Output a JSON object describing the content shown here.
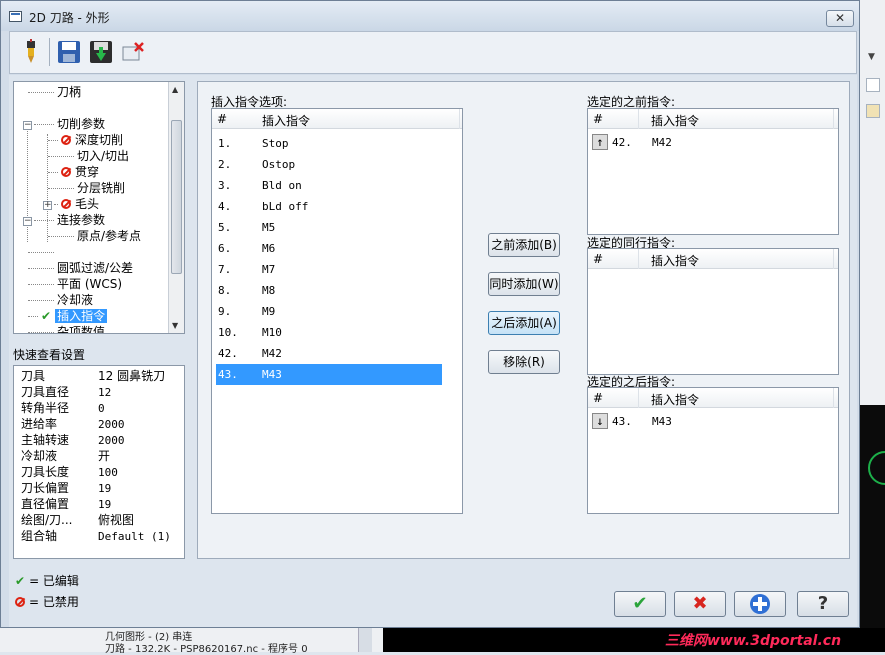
{
  "window": {
    "title": "2D 刀路 - 外形",
    "close": "✕"
  },
  "toolbar": {
    "icons": [
      "tool-icon",
      "save-icon",
      "save-green-icon",
      "delete-icon"
    ]
  },
  "tree": {
    "items": [
      {
        "label": "刀柄",
        "state": "none"
      },
      {
        "label": "切削参数",
        "state": "none"
      },
      {
        "label": "深度切削",
        "state": "disabled"
      },
      {
        "label": "切入/切出",
        "state": "none"
      },
      {
        "label": "贯穿",
        "state": "disabled"
      },
      {
        "label": "分层铣削",
        "state": "none"
      },
      {
        "label": "毛头",
        "state": "disabled"
      },
      {
        "label": "连接参数",
        "state": "none"
      },
      {
        "label": "原点/参考点",
        "state": "none"
      },
      {
        "label": "",
        "state": "none"
      },
      {
        "label": "圆弧过滤/公差",
        "state": "none"
      },
      {
        "label": "平面 (WCS)",
        "state": "none"
      },
      {
        "label": "冷却液",
        "state": "none"
      },
      {
        "label": "插入指令",
        "state": "edited"
      },
      {
        "label": "杂项数值",
        "state": "none"
      }
    ]
  },
  "quick_view": {
    "title": "快速查看设置",
    "rows": [
      {
        "k": "刀具",
        "v": "12 圆鼻铣刀"
      },
      {
        "k": "刀具直径",
        "v": "12"
      },
      {
        "k": "转角半径",
        "v": "0"
      },
      {
        "k": "进给率",
        "v": "2000"
      },
      {
        "k": "主轴转速",
        "v": "2000"
      },
      {
        "k": "冷却液",
        "v": "开"
      },
      {
        "k": "刀具长度",
        "v": "100"
      },
      {
        "k": "刀长偏置",
        "v": "19"
      },
      {
        "k": "直径偏置",
        "v": "19"
      },
      {
        "k": "绘图/刀...",
        "v": "俯视图"
      },
      {
        "k": "组合轴",
        "v": "Default (1)"
      }
    ]
  },
  "legend": {
    "edited": "= 已编辑",
    "disabled": "= 已禁用"
  },
  "options": {
    "label": "插入指令选项:",
    "col_num": "#",
    "col_cmd": "插入指令",
    "items": [
      {
        "n": "1.",
        "t": "Stop"
      },
      {
        "n": "2.",
        "t": "Ostop"
      },
      {
        "n": "3.",
        "t": "Bld on"
      },
      {
        "n": "4.",
        "t": "bLd off"
      },
      {
        "n": "5.",
        "t": "M5"
      },
      {
        "n": "6.",
        "t": "M6"
      },
      {
        "n": "7.",
        "t": "M7"
      },
      {
        "n": "8.",
        "t": "M8"
      },
      {
        "n": "9.",
        "t": "M9"
      },
      {
        "n": "10.",
        "t": "M10"
      },
      {
        "n": "42.",
        "t": "M42"
      },
      {
        "n": "43.",
        "t": "M43"
      }
    ]
  },
  "buttons": {
    "add_before": "之前添加(B)",
    "add_same": "同时添加(W)",
    "add_after": "之后添加(A)",
    "remove": "移除(R)"
  },
  "before": {
    "label": "选定的之前指令:",
    "col_num": "#",
    "col_cmd": "插入指令",
    "items": [
      {
        "n": "42.",
        "t": "M42"
      }
    ]
  },
  "same": {
    "label": "选定的同行指令:",
    "col_num": "#",
    "col_cmd": "插入指令"
  },
  "after": {
    "label": "选定的之后指令:",
    "col_num": "#",
    "col_cmd": "插入指令",
    "items": [
      {
        "n": "43.",
        "t": "M43"
      }
    ]
  },
  "dialog_buttons": {
    "ok": "✔",
    "cancel": "✖",
    "help": "?"
  },
  "background": {
    "line1": "几何图形 - (2) 串连",
    "line2": "刀路 - 132.2K - PSP8620167.nc - 程序号 0",
    "watermark": "三维网www.3dportal.cn"
  }
}
